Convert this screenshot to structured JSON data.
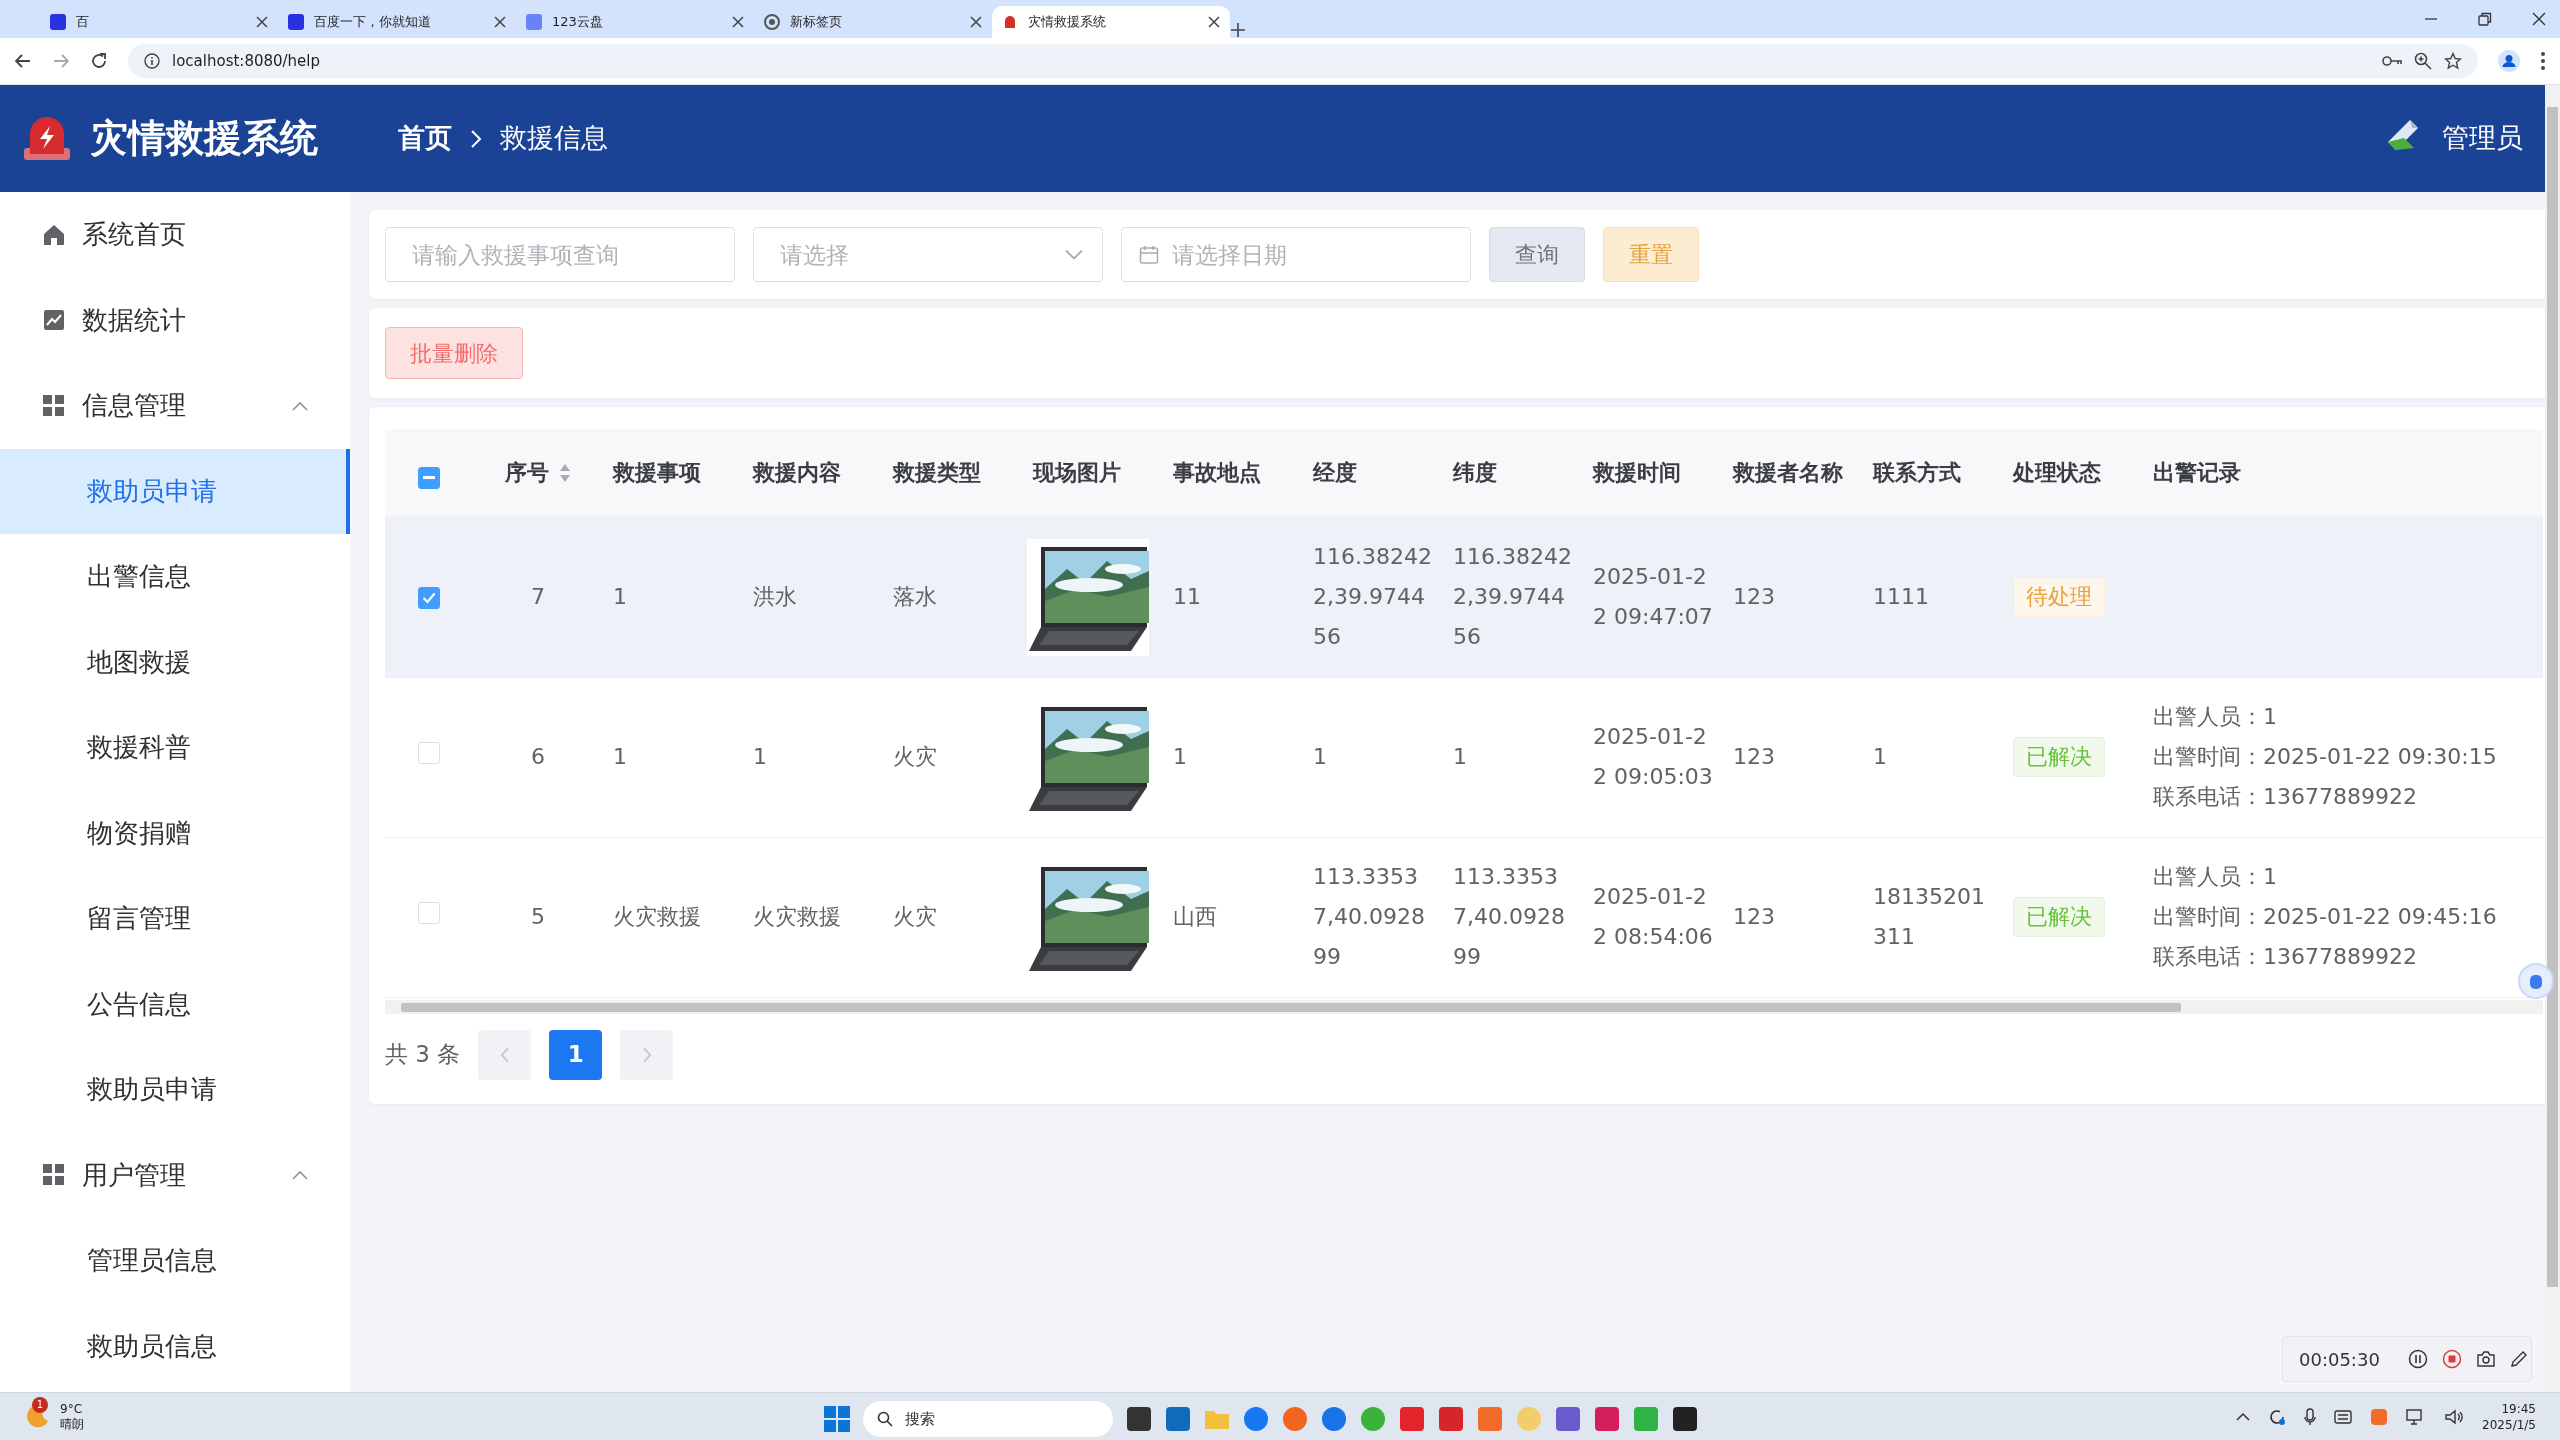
{
  "browser": {
    "tabs": [
      {
        "label": "百",
        "selected": false
      },
      {
        "label": "百度一下，你就知道",
        "selected": false
      },
      {
        "label": "123云盘",
        "selected": false
      },
      {
        "label": "新标签页",
        "selected": false
      },
      {
        "label": "灾情救援系统",
        "selected": true
      }
    ],
    "address": "localhost:8080/help"
  },
  "header": {
    "title": "灾情救援系统",
    "breadcrumb": [
      "首页",
      "救援信息"
    ],
    "user": "管理员"
  },
  "sidebar": {
    "items": [
      {
        "kind": "home",
        "label": "系统首页",
        "selected": false
      },
      {
        "kind": "chart",
        "label": "数据统计",
        "selected": false
      },
      {
        "kind": "group",
        "label": "信息管理",
        "expanded": true,
        "children": [
          {
            "label": "救助员申请",
            "selected": true
          },
          {
            "label": "出警信息",
            "selected": false
          },
          {
            "label": "地图救援",
            "selected": false
          },
          {
            "label": "救援科普",
            "selected": false
          },
          {
            "label": "物资捐赠",
            "selected": false
          },
          {
            "label": "留言管理",
            "selected": false
          },
          {
            "label": "公告信息",
            "selected": false
          },
          {
            "label": "救助员申请",
            "selected": false
          }
        ]
      },
      {
        "kind": "group",
        "label": "用户管理",
        "expanded": true,
        "children": [
          {
            "label": "管理员信息",
            "selected": false
          },
          {
            "label": "救助员信息",
            "selected": false
          }
        ]
      }
    ]
  },
  "filters": {
    "search": {
      "placeholder": "请输入救援事项查询"
    },
    "select": {
      "placeholder": "请选择"
    },
    "date": {
      "placeholder": "请选择日期"
    },
    "query_button": "查询",
    "reset_button": "重置"
  },
  "batch_delete_button": "批量删除",
  "table": {
    "header_checkbox": {
      "indeterminate": true
    },
    "columns": [
      {
        "label": "序号",
        "sortable": true
      },
      {
        "label": "救援事项",
        "sortable": false
      },
      {
        "label": "救援内容",
        "sortable": false
      },
      {
        "label": "救援类型",
        "sortable": false
      },
      {
        "label": "现场图片",
        "sortable": false
      },
      {
        "label": "事故地点",
        "sortable": false
      },
      {
        "label": "经度",
        "sortable": false
      },
      {
        "label": "纬度",
        "sortable": false
      },
      {
        "label": "救援时间",
        "sortable": false
      },
      {
        "label": "救援者名称",
        "sortable": false
      },
      {
        "label": "联系方式",
        "sortable": false
      },
      {
        "label": "处理状态",
        "sortable": false
      },
      {
        "label": "出警记录",
        "sortable": false
      }
    ],
    "rows": [
      {
        "checked": true,
        "hovered": true,
        "cells": [
          "7",
          "1",
          "洪水",
          "落水",
          {
            "kind": "picture"
          },
          "11",
          "116.382422,39.974456",
          "116.382422,39.974456",
          "2025-01-22 09:47:07",
          "123",
          "1111"
        ],
        "status": {
          "text": "待处理",
          "kind": "warning"
        }
      },
      {
        "checked": false,
        "hovered": false,
        "cells": [
          "6",
          "1",
          "1",
          "火灾",
          {
            "kind": "picture"
          },
          "1",
          "1",
          "1",
          "2025-01-22 09:05:03",
          "123",
          "1"
        ],
        "status": {
          "text": "已解决",
          "kind": "success"
        },
        "record": [
          "出警人员：1",
          "出警时间：2025-01-22 09:30:15",
          "联系电话：13677889922"
        ]
      },
      {
        "checked": false,
        "hovered": false,
        "cells": [
          "5",
          "火灾救援",
          "火灾救援",
          "火灾",
          {
            "kind": "picture"
          },
          "山西",
          "113.33537,40.092899",
          "113.33537,40.092899",
          "2025-01-22 08:54:06",
          "123",
          "18135201311"
        ],
        "status": {
          "text": "已解决",
          "kind": "success"
        },
        "record": [
          "出警人员：1",
          "出警时间：2025-01-22 09:45:16",
          "联系电话：13677889922"
        ]
      }
    ]
  },
  "pagination": {
    "total": "共 3 条",
    "pages": [
      {
        "label": "1",
        "selected": true
      }
    ]
  },
  "recorder": {
    "time": "00:05:30"
  },
  "taskbar": {
    "weather": {
      "badge": "1",
      "temperature": "9°C",
      "condition": "晴朗"
    },
    "search": "搜索",
    "time": "19:45",
    "date": "2025/1/5"
  }
}
